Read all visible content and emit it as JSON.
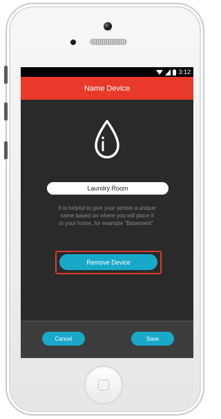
{
  "status_bar": {
    "time": "3:12",
    "icons": [
      "wifi-icon",
      "cell-signal-icon",
      "battery-icon"
    ]
  },
  "header": {
    "title": "Name Device"
  },
  "sensor": {
    "icon": "water-drop-icon"
  },
  "name_field": {
    "value": "Laundry Room"
  },
  "help_text": "It is helpful to give your sensor a unique\nname based on where you will place it\nin your home, for example \"Basement\".",
  "actions": {
    "remove_label": "Remove Device",
    "cancel_label": "Cancel",
    "save_label": "Save"
  },
  "colors": {
    "header_red": "#e8392b",
    "accent_teal": "#19a9c8",
    "screen_bg": "#2a2a2a",
    "highlight_red": "#d93a2e"
  }
}
